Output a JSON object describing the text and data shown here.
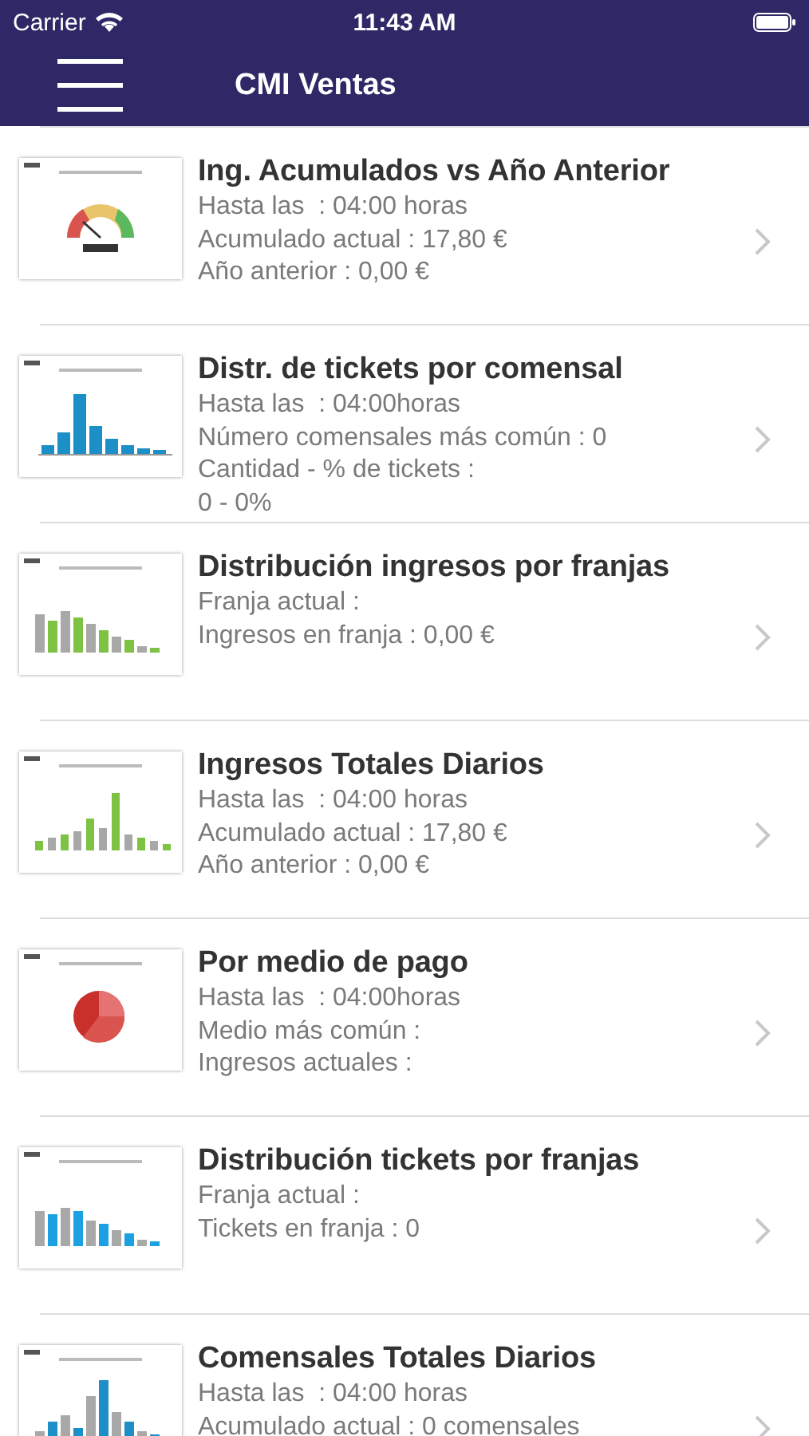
{
  "status_bar": {
    "carrier": "Carrier",
    "time": "11:43 AM"
  },
  "nav_bar": {
    "title": "CMI Ventas"
  },
  "items": [
    {
      "kind": "gauge",
      "title": "Ing. Acumulados vs Año Anterior",
      "lines": [
        "Hasta las  : 04:00 horas",
        "Acumulado actual : 17,80 €",
        "Año anterior : 0,00 €"
      ]
    },
    {
      "kind": "bars",
      "title": "Distr. de tickets por comensal",
      "lines": [
        "Hasta las  : 04:00horas",
        "Número comensales más común : 0",
        "Cantidad - % de tickets :",
        "0 - 0%"
      ]
    },
    {
      "kind": "grouped",
      "title": "Distribución ingresos por franjas",
      "lines": [
        "Franja actual :",
        "Ingresos en franja : 0,00 €"
      ]
    },
    {
      "kind": "daily",
      "title": "Ingresos Totales Diarios",
      "lines": [
        "Hasta las  : 04:00 horas",
        "Acumulado actual : 17,80 €",
        "Año anterior : 0,00 €"
      ]
    },
    {
      "kind": "pie",
      "title": "Por medio de pago",
      "lines": [
        "Hasta las  : 04:00horas",
        "Medio más común :",
        "Ingresos actuales :"
      ]
    },
    {
      "kind": "grouped-blue",
      "title": "Distribución tickets por franjas",
      "lines": [
        "Franja actual :",
        "Tickets en franja : 0"
      ]
    },
    {
      "kind": "daily-blue",
      "title": "Comensales Totales Diarios",
      "lines": [
        "Hasta las  : 04:00 horas",
        "Acumulado actual : 0 comensales"
      ]
    }
  ]
}
